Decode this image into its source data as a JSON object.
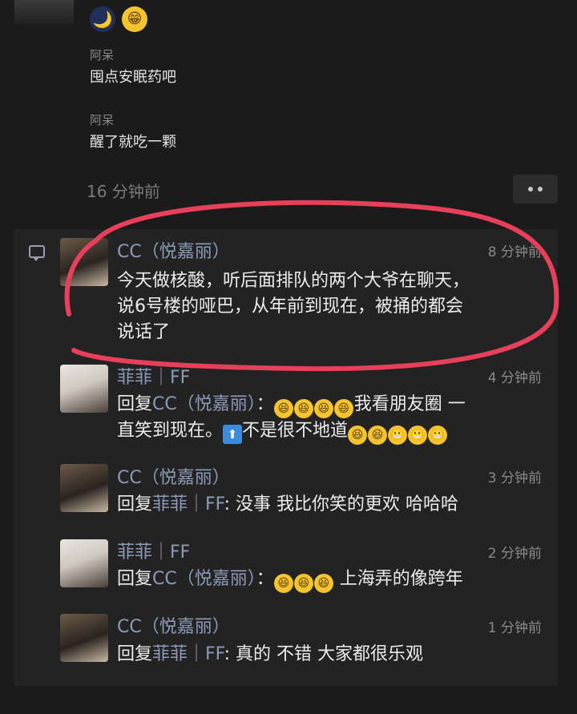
{
  "top_emojis": [
    "🌙",
    "😁"
  ],
  "posts": [
    {
      "name": "阿呆",
      "text": "囤点安眠药吧"
    },
    {
      "name": "阿呆",
      "text": "醒了就吃一颗"
    }
  ],
  "post_time": "16 分钟前",
  "comments": [
    {
      "name": "CC（悦嘉丽）",
      "time": "8 分钟前",
      "lines": [
        "今天做核酸，听后面排队的两个大爷在聊天，",
        "说6号楼的哑巴，从年前到现在，被捅的都会",
        "说话了"
      ]
    },
    {
      "name": "菲菲｜FF",
      "time": "4 分钟前",
      "reply_prefix": "回复",
      "reply_to": "CC（悦嘉丽）",
      "colon": "：",
      "line1_emojis": [
        "😆",
        "😆",
        "😆",
        "😆"
      ],
      "line1_text": "我看朋友圈 一",
      "line2_text": "直笑到现在。",
      "up_icon": "⬆",
      "line2_rest": "不是很不地道",
      "line2_emojis": [
        "😆",
        "😆",
        "😬",
        "😬",
        "😬"
      ]
    },
    {
      "name": "CC（悦嘉丽）",
      "time": "3 分钟前",
      "reply_prefix": "回复",
      "reply_to": "菲菲｜FF",
      "colon": ":",
      "text": " 没事 我比你笑的更欢 哈哈哈"
    },
    {
      "name": "菲菲｜FF",
      "time": "2 分钟前",
      "reply_prefix": "回复",
      "reply_to": "CC（悦嘉丽）",
      "colon": "：",
      "emojis": [
        "😆",
        "😆",
        "😆"
      ],
      "text": " 上海弄的像跨年"
    },
    {
      "name": "CC（悦嘉丽）",
      "time": "1 分钟前",
      "reply_prefix": "回复",
      "reply_to": "菲菲｜FF",
      "colon": ":",
      "text": " 真的 不错 大家都很乐观"
    }
  ],
  "colors": {
    "background": "#1b1b1b",
    "panel": "#232323",
    "name_blue": "#8d9bb9",
    "annotation_red": "#e8405a"
  },
  "icons": [
    "moon-icon",
    "grin-icon",
    "more-dots-icon",
    "comment-icon",
    "laugh-emoji-icon",
    "up-arrow-icon"
  ]
}
